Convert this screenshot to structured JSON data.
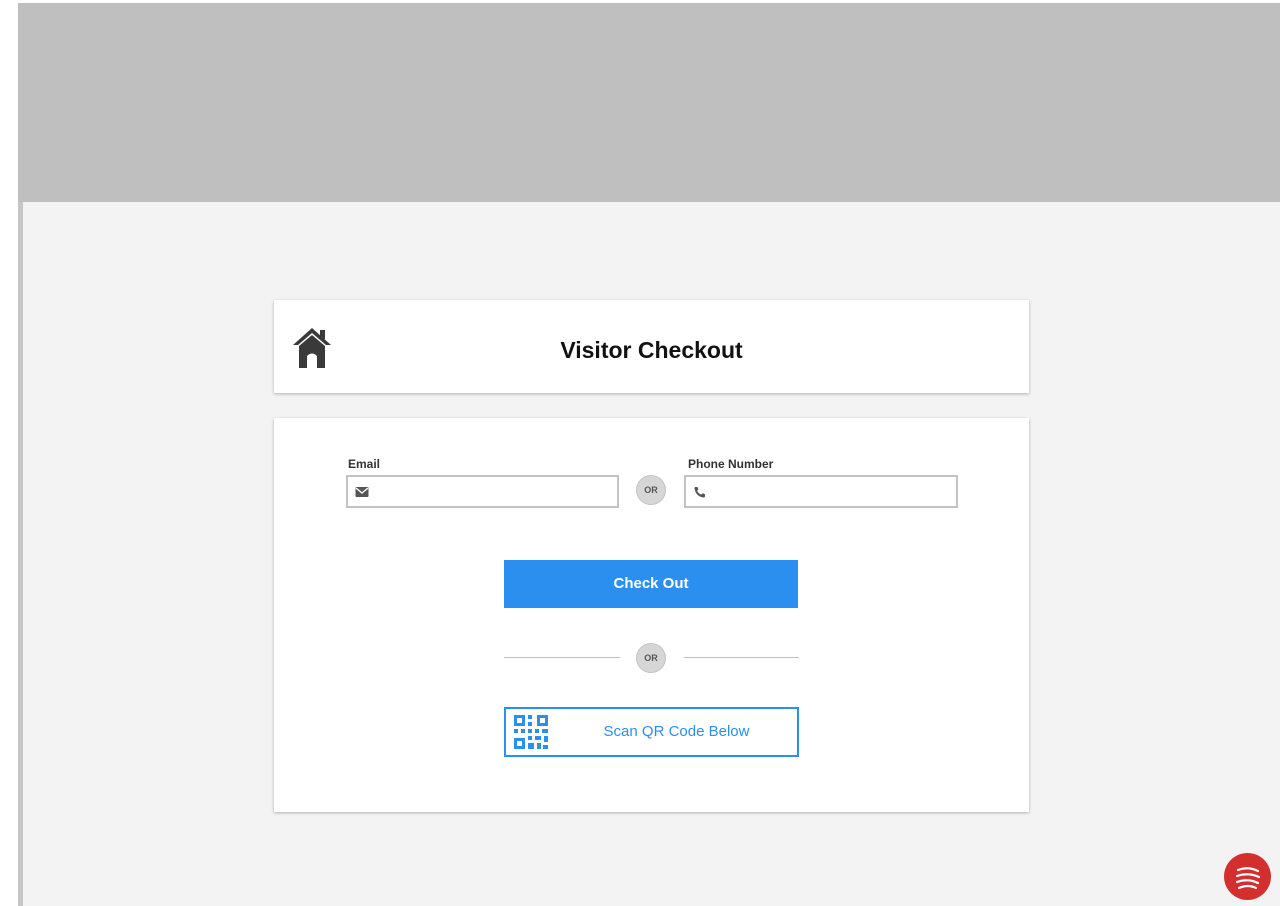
{
  "header": {
    "title": "Visitor Checkout",
    "home_icon": "home-icon"
  },
  "form": {
    "email": {
      "label": "Email",
      "value": "",
      "placeholder": "",
      "icon": "envelope-icon"
    },
    "separator_text": "OR",
    "phone": {
      "label": "Phone Number",
      "value": "",
      "placeholder": "",
      "icon": "phone-icon"
    },
    "checkout_button": "Check Out",
    "divider_text": "OR",
    "qr_button": {
      "label": "Scan QR Code Below",
      "icon": "qr-code-icon"
    }
  },
  "brand": {
    "icon": "brand-logo-icon"
  },
  "colors": {
    "accent": "#2b8ff0",
    "banner": "#bfbfbf",
    "background": "#f3f3f3",
    "brand": "#d32f2f"
  }
}
